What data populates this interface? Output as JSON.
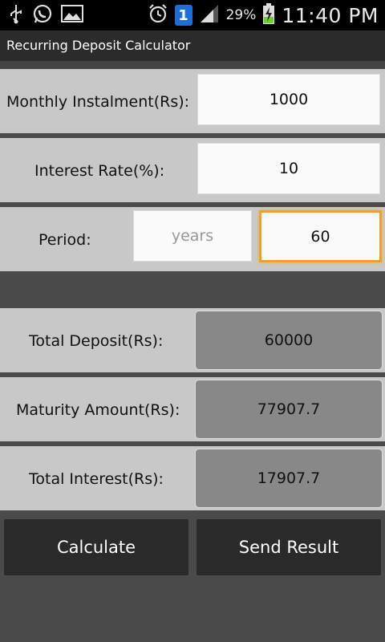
{
  "statusbar": {
    "battery": "29%",
    "time": "11:40 PM",
    "notif_badge": "1"
  },
  "app": {
    "title": "Recurring Deposit Calculator"
  },
  "inputs": {
    "monthly_label": "Monthly Instalment(Rs):",
    "monthly_value": "1000",
    "rate_label": "Interest Rate(%):",
    "rate_value": "10",
    "period_label": "Period:",
    "years_placeholder": "years",
    "months_value": "60"
  },
  "results": {
    "deposit_label": "Total Deposit(Rs):",
    "deposit_value": "60000",
    "maturity_label": "Maturity Amount(Rs):",
    "maturity_value": "77907.7",
    "interest_label": "Total Interest(Rs):",
    "interest_value": "17907.7"
  },
  "buttons": {
    "calculate": "Calculate",
    "send_result": "Send Result"
  },
  "colors": {
    "focus": "#f0a030",
    "badge": "#1d6fd6",
    "charging": "#6ccf2a"
  }
}
